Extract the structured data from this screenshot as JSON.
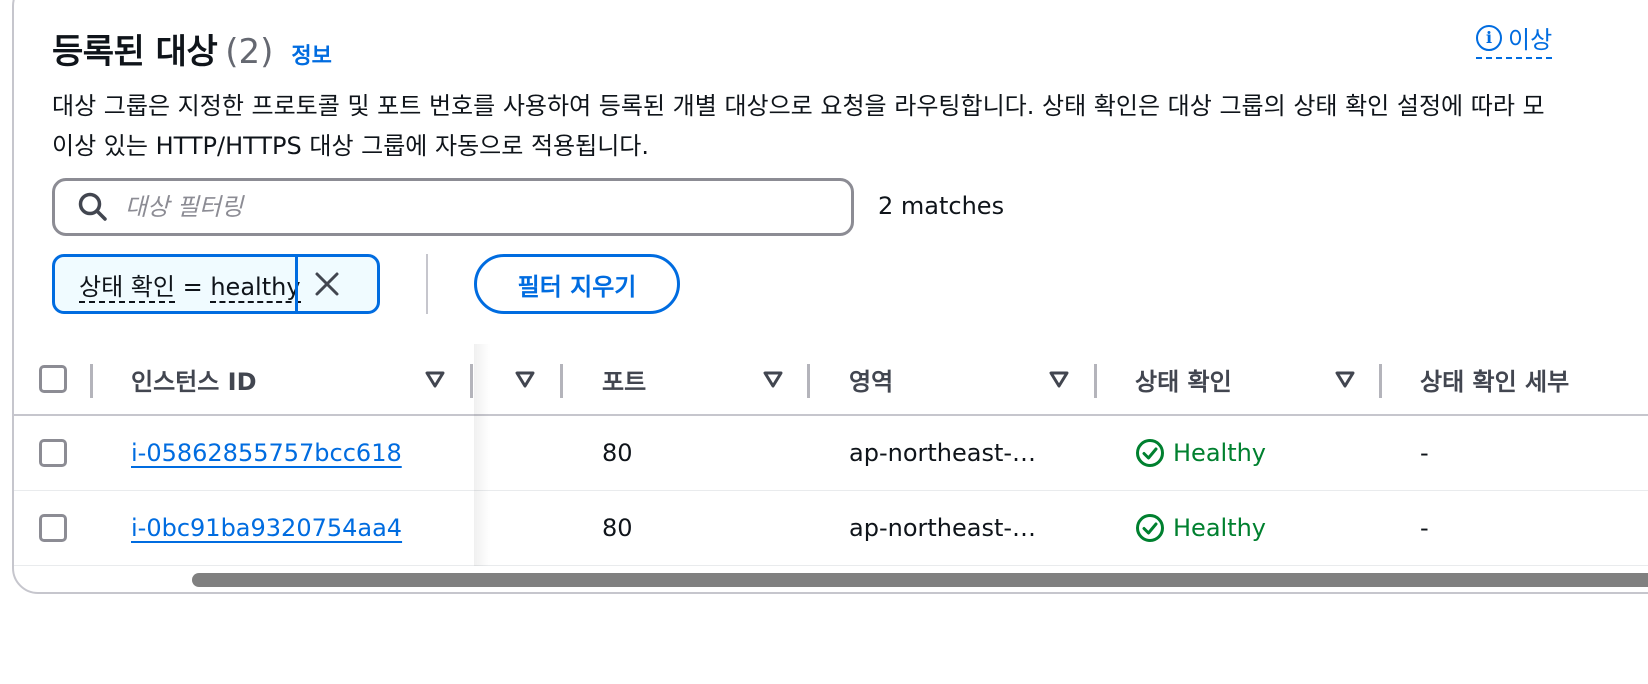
{
  "header": {
    "title": "등록된 대상",
    "count": "(2)",
    "info_link": "정보",
    "learn_more": "이상"
  },
  "description": {
    "line1": "대상 그룹은 지정한 프로토콜 및 포트 번호를 사용하여 등록된 개별 대상으로 요청을 라우팅합니다. 상태 확인은 대상 그룹의 상태 확인 설정에 따라 모",
    "line2": "이상 있는 HTTP/HTTPS 대상 그룹에 자동으로 적용됩니다."
  },
  "search": {
    "placeholder": "대상 필터링",
    "value": "",
    "matches": "2 matches"
  },
  "filter_token": {
    "property": "상태 확인",
    "operator": "=",
    "value": "healthy"
  },
  "clear_filters_label": "필터 지우기",
  "table": {
    "columns": [
      {
        "label": "인스턴스 ID"
      },
      {
        "label": ""
      },
      {
        "label": "포트"
      },
      {
        "label": "영역"
      },
      {
        "label": "상태 확인"
      },
      {
        "label": "상태 확인 세부"
      }
    ],
    "rows": [
      {
        "instance_id": "i-05862855757bcc618",
        "port": "80",
        "zone": "ap-northeast-…",
        "health": "Healthy",
        "health_detail": "-"
      },
      {
        "instance_id": "i-0bc91ba9320754aa4",
        "port": "80",
        "zone": "ap-northeast-…",
        "health": "Healthy",
        "health_detail": "-"
      }
    ]
  },
  "colors": {
    "link": "#006ce0",
    "healthy": "#00802f",
    "border": "#c6c6cd"
  }
}
